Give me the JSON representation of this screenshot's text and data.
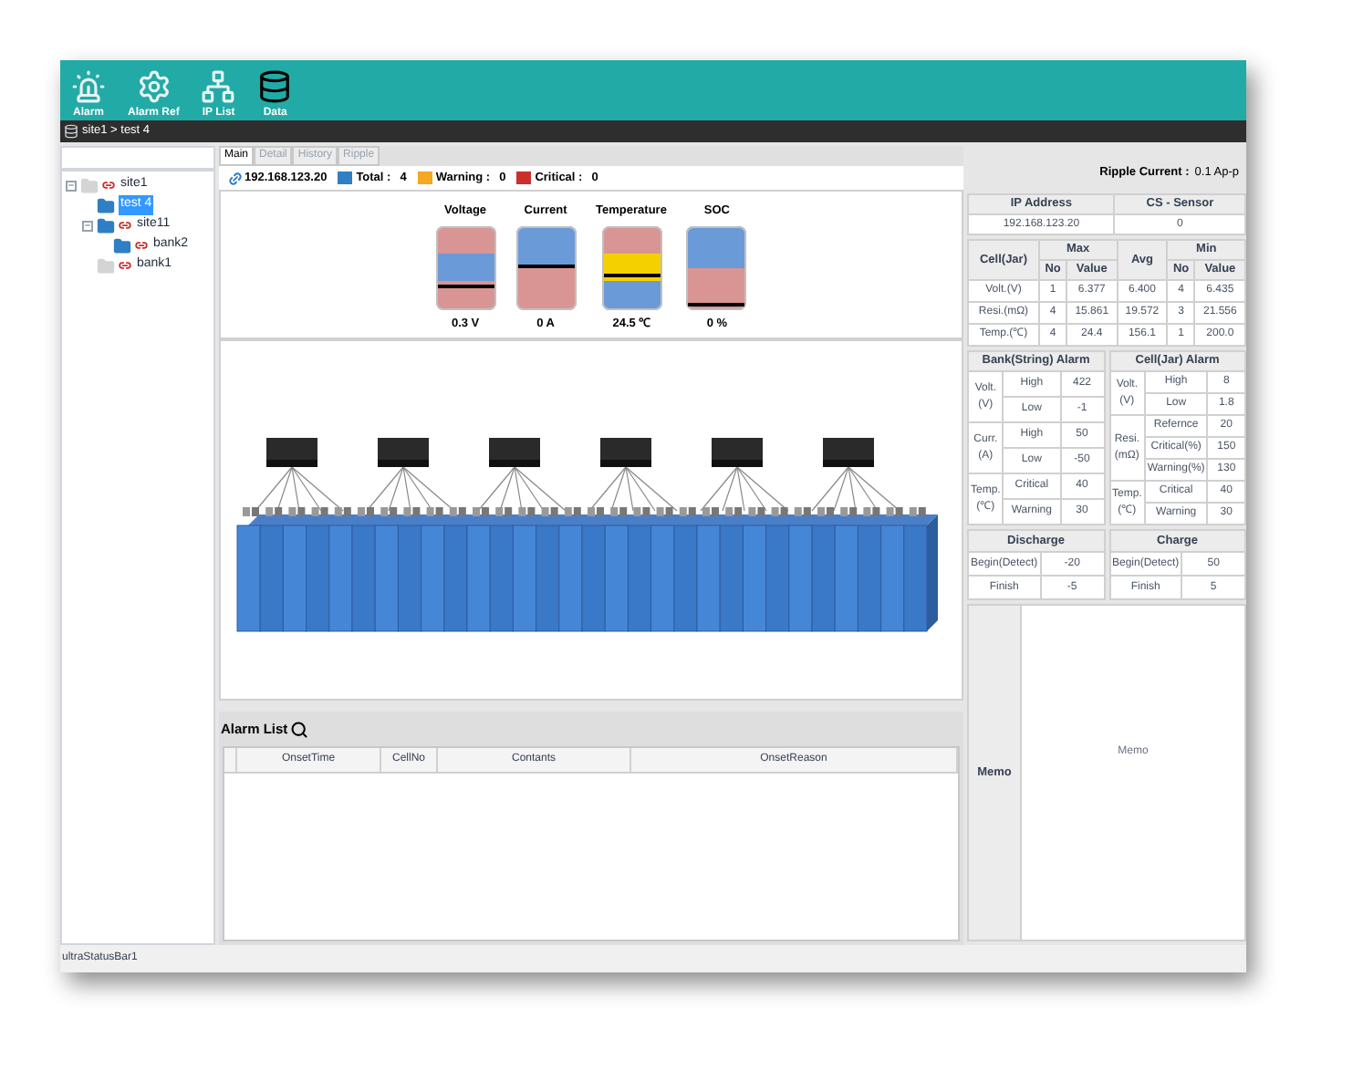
{
  "toolbar": [
    {
      "label": "Alarm",
      "kind": "alarm"
    },
    {
      "label": "Alarm Ref",
      "kind": "settings"
    },
    {
      "label": "IP List",
      "kind": "network"
    },
    {
      "label": "Data",
      "kind": "data"
    }
  ],
  "breadcrumb": "site1 > test 4",
  "tree": [
    {
      "label": "site1",
      "color": "#d4d4d4",
      "linked": true,
      "selected": false,
      "expanded": true,
      "children": [
        {
          "label": "test 4",
          "color": "#2f7fc4",
          "linked": false,
          "selected": true
        },
        {
          "label": "site11",
          "color": "#2f7fc4",
          "linked": true,
          "selected": false,
          "expanded": true,
          "children": [
            {
              "label": "bank2",
              "color": "#2f7fc4",
              "linked": true,
              "selected": false
            }
          ]
        },
        {
          "label": "bank1",
          "color": "#d4d4d4",
          "linked": true,
          "selected": false
        }
      ]
    }
  ],
  "tabs": [
    {
      "label": "Main",
      "selected": true
    },
    {
      "label": "Detail",
      "selected": false
    },
    {
      "label": "History",
      "selected": false
    },
    {
      "label": "Ripple",
      "selected": false
    }
  ],
  "status": {
    "ip": "192.168.123.20",
    "counts": [
      {
        "label": "Total :",
        "value": "4",
        "color": "#2f7fc4"
      },
      {
        "label": "Warning :",
        "value": "0",
        "color": "#f5a623"
      },
      {
        "label": "Critical :",
        "value": "0",
        "color": "#c9302c"
      }
    ],
    "ripple_label": "Ripple Current :",
    "ripple_value": "0.1 Ap-p"
  },
  "gauges": [
    {
      "title": "Voltage",
      "reading": "0.3 V",
      "level": 0.25,
      "zones": [
        {
          "color": "#d99594"
        },
        {
          "color": "#6a9ad8"
        },
        {
          "color": "#d99594"
        }
      ]
    },
    {
      "title": "Current",
      "reading": "0 A",
      "level": 0.5,
      "zones": [
        {
          "color": "#6a9ad8"
        },
        {
          "color": "#d99594"
        }
      ]
    },
    {
      "title": "Temperature",
      "reading": "24.5 ℃",
      "level": 0.37,
      "zones": [
        {
          "color": "#d99594"
        },
        {
          "color": "#f5d000"
        },
        {
          "color": "#6a9ad8"
        }
      ]
    },
    {
      "title": "SOC",
      "reading": "0 %",
      "level": 0.02,
      "zones": [
        {
          "color": "#6a9ad8"
        },
        {
          "color": "#d99594"
        }
      ]
    }
  ],
  "alarm_list": {
    "title": "Alarm List",
    "columns": [
      "OnsetTime",
      "CellNo",
      "Contants",
      "OnsetReason"
    ]
  },
  "ip_table": {
    "columns": [
      "IP Address",
      "CS - Sensor"
    ],
    "values": [
      "192.168.123.20",
      "0"
    ]
  },
  "cell_table": {
    "corner": "Cell(Jar)",
    "max": "Max",
    "avg": "Avg",
    "min": "Min",
    "sub": [
      "No",
      "Value",
      "No",
      "Value"
    ],
    "rows": [
      [
        "Volt.(V)",
        "1",
        "6.377",
        "6.400",
        "4",
        "6.435"
      ],
      [
        "Resi.(mΩ)",
        "4",
        "15.861",
        "19.572",
        "3",
        "21.556"
      ],
      [
        "Temp.(℃)",
        "4",
        "24.4",
        "156.1",
        "1",
        "200.0"
      ]
    ]
  },
  "alarms": [
    {
      "title": "Bank(String) Alarm",
      "groups": [
        {
          "label": "Volt.\n(V)",
          "rows": [
            [
              "High",
              "422"
            ],
            [
              "Low",
              "-1"
            ]
          ]
        },
        {
          "label": "Curr.\n(A)",
          "rows": [
            [
              "High",
              "50"
            ],
            [
              "Low",
              "-50"
            ]
          ]
        },
        {
          "label": "Temp.\n(℃)",
          "rows": [
            [
              "Critical",
              "40"
            ],
            [
              "Warning",
              "30"
            ]
          ]
        }
      ]
    },
    {
      "title": "Cell(Jar) Alarm",
      "groups": [
        {
          "label": "Volt.\n(V)",
          "rows": [
            [
              "High",
              "8"
            ],
            [
              "Low",
              "1.8"
            ]
          ]
        },
        {
          "label": "Resi.\n(mΩ)",
          "rows": [
            [
              "Refernce",
              "20"
            ],
            [
              "Critical(%)",
              "150"
            ],
            [
              "Warning(%)",
              "130"
            ]
          ]
        },
        {
          "label": "Temp.\n(℃)",
          "rows": [
            [
              "Critical",
              "40"
            ],
            [
              "Warning",
              "30"
            ]
          ]
        }
      ]
    }
  ],
  "charge": [
    {
      "title": "Discharge",
      "rows": [
        [
          "Begin(Detect)",
          "-20"
        ],
        [
          "Finish",
          "-5"
        ]
      ]
    },
    {
      "title": "Charge",
      "rows": [
        [
          "Begin(Detect)",
          "50"
        ],
        [
          "Finish",
          "5"
        ]
      ]
    }
  ],
  "memo": {
    "label": "Memo",
    "placeholder": "Memo"
  },
  "status_bar": "ultraStatusBar1"
}
